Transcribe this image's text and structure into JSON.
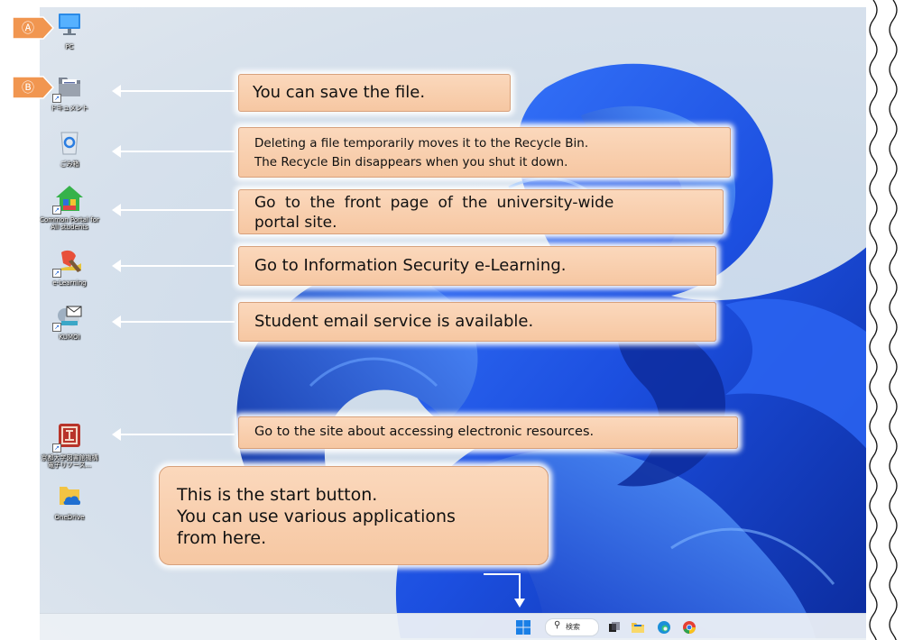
{
  "badges": {
    "a": "Ⓐ",
    "b": "Ⓑ"
  },
  "icons": {
    "pc": "PC",
    "documents": "ドキュメント",
    "recycle_bin": "ごみ箱",
    "common_portal": "Common Portal for All students",
    "elearning": "e-Learning",
    "kumoi": "KUMOI",
    "library": "京都大学図書館機構 電子リソース...",
    "onedrive": "OneDrive"
  },
  "callouts": {
    "save": "You can save the file.",
    "recycle_line1": "Deleting a file temporarily moves it to the Recycle Bin.",
    "recycle_line2": "The Recycle Bin disappears when you shut it down.",
    "portal_line1": "Go to the front page of the university-wide",
    "portal_line2": "portal site.",
    "elearning": "Go to Information Security e-Learning.",
    "email": "Student email service is available.",
    "electronic": "Go to the site about accessing electronic resources.",
    "start_line1": "This is the start button.",
    "start_line2": "You can use various applications",
    "start_line3": "from here."
  },
  "taskbar": {
    "search_label": "検索"
  },
  "colors": {
    "callout_fill": "#f8cfb0",
    "callout_border": "#d7a17c",
    "badge": "#f19650",
    "taskbar": "#eef1f6"
  }
}
